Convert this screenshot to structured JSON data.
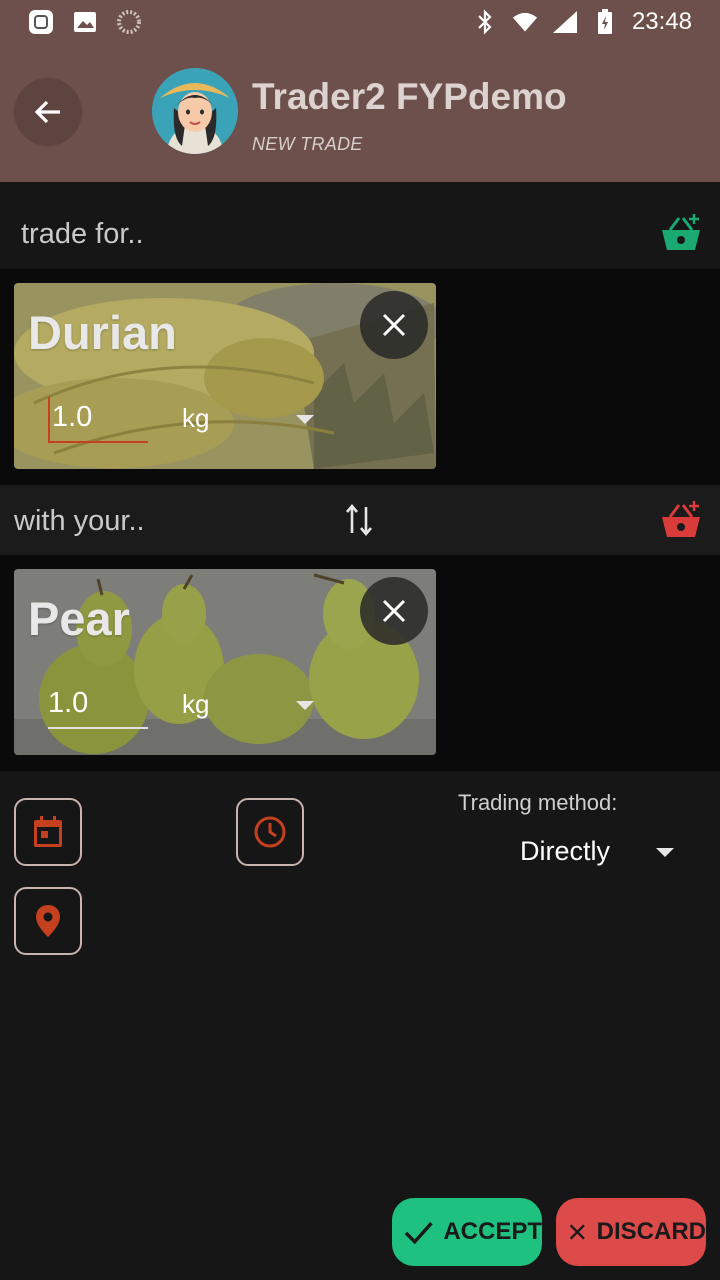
{
  "status_bar": {
    "time": "23:48",
    "left_icons": [
      "mi-app-icon",
      "gallery-icon",
      "loading-icon"
    ],
    "right_icons": [
      "bluetooth-icon",
      "wifi-icon",
      "cell-signal-icon",
      "battery-charging-icon"
    ]
  },
  "app_bar": {
    "title": "Trader2 FYPdemo",
    "subtitle": "NEW TRADE"
  },
  "trade_for": {
    "label": "trade for..",
    "basket_color": "#1aa970",
    "items": [
      {
        "name": "Durian",
        "quantity": "1.0",
        "unit": "kg"
      }
    ]
  },
  "with_your": {
    "label": "with your..",
    "basket_color": "#d93b3b",
    "items": [
      {
        "name": "Pear",
        "quantity": "1.0",
        "unit": "kg"
      }
    ]
  },
  "trading": {
    "label": "Trading method:",
    "selected": "Directly"
  },
  "actions": {
    "accept": "ACCEPT",
    "discard": "DISCARD"
  },
  "colors": {
    "app_bar": "#6d4f4b",
    "accent_red": "#c5401f",
    "accept": "#1ec180",
    "discard": "#dd4a4a"
  }
}
